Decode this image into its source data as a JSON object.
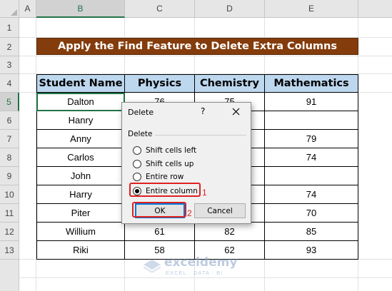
{
  "columns": [
    "A",
    "B",
    "C",
    "D",
    "E"
  ],
  "selected_column": "B",
  "rows": [
    "1",
    "2",
    "3",
    "4",
    "5",
    "6",
    "7",
    "8",
    "9",
    "10",
    "11",
    "12",
    "13"
  ],
  "selected_row": "5",
  "title": "Apply the Find Feature to Delete Extra Columns",
  "table": {
    "headers": [
      "Student Name",
      "Physics",
      "Chemistry",
      "Mathematics"
    ],
    "rows": [
      [
        "Dalton",
        "76",
        "75",
        "91"
      ],
      [
        "Hanry",
        "",
        "",
        ""
      ],
      [
        "Anny",
        "",
        "",
        "79"
      ],
      [
        "Carlos",
        "",
        "",
        "74"
      ],
      [
        "John",
        "",
        "",
        ""
      ],
      [
        "Harry",
        "",
        "",
        "74"
      ],
      [
        "Piter",
        "",
        "",
        "70"
      ],
      [
        "Willium",
        "61",
        "82",
        "85"
      ],
      [
        "Riki",
        "58",
        "62",
        "93"
      ]
    ]
  },
  "dialog": {
    "title": "Delete",
    "help": "?",
    "close_icon": "close-icon",
    "group_label": "Delete",
    "options": [
      {
        "label": "Shift cells left",
        "checked": false
      },
      {
        "label": "Shift cells up",
        "checked": false
      },
      {
        "label": "Entire row",
        "checked": false
      },
      {
        "label": "Entire column",
        "checked": true
      }
    ],
    "ok_label": "OK",
    "cancel_label": "Cancel"
  },
  "callouts": [
    "1",
    "2"
  ],
  "watermark": {
    "name": "exceldemy",
    "sub": "EXCEL · DATA · BI"
  },
  "colors": {
    "title_bg": "#843c0c",
    "header_bg": "#bdd7ee",
    "accent_green": "#217346",
    "callout_red": "#e02020"
  }
}
